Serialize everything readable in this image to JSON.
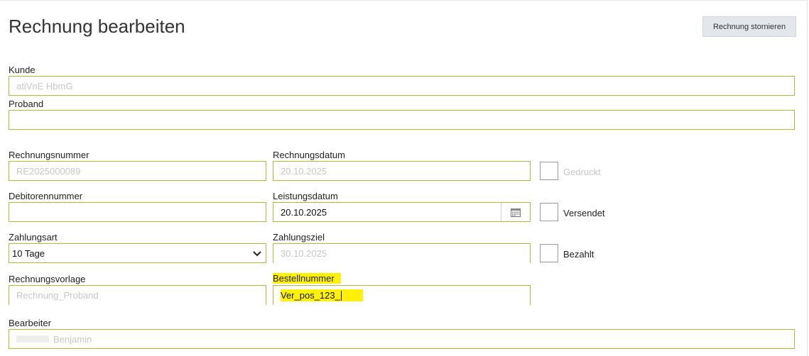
{
  "header": {
    "title": "Rechnung bearbeiten",
    "cancel_button": "Rechnung stornieren"
  },
  "fields": {
    "kunde": {
      "label": "Kunde",
      "value": "atiVnE HbmG"
    },
    "proband": {
      "label": "Proband",
      "value": ""
    },
    "rechnungsnummer": {
      "label": "Rechnungsnummer",
      "value": "RE2025000089"
    },
    "rechnungsdatum": {
      "label": "Rechnungsdatum",
      "value": "20.10.2025"
    },
    "debitorennummer": {
      "label": "Debitorennummer",
      "value": ""
    },
    "leistungsdatum": {
      "label": "Leistungsdatum",
      "value": "20.10.2025"
    },
    "zahlungsart": {
      "label": "Zahlungsart",
      "value": "10 Tage"
    },
    "zahlungsziel": {
      "label": "Zahlungsziel",
      "value": "30.10.2025"
    },
    "rechnungsvorlage": {
      "label": "Rechnungsvorlage",
      "value": "Rechnung_Proband"
    },
    "bestellnummer": {
      "label": "Bestellnummer",
      "value": "Ver_pos_123_"
    },
    "bearbeiter": {
      "label": "Bearbeiter",
      "value": "Benjamin"
    }
  },
  "checkboxes": {
    "gedruckt": {
      "label": "Gedruckt",
      "checked": false
    },
    "versendet": {
      "label": "Versendet",
      "checked": false
    },
    "bezahlt": {
      "label": "Bezahlt",
      "checked": false
    }
  },
  "colors": {
    "border": "#a7c03a",
    "highlight": "#fff200"
  },
  "icons": {
    "calendar": "calendar-icon",
    "dropdown": "chevron-down-icon"
  }
}
